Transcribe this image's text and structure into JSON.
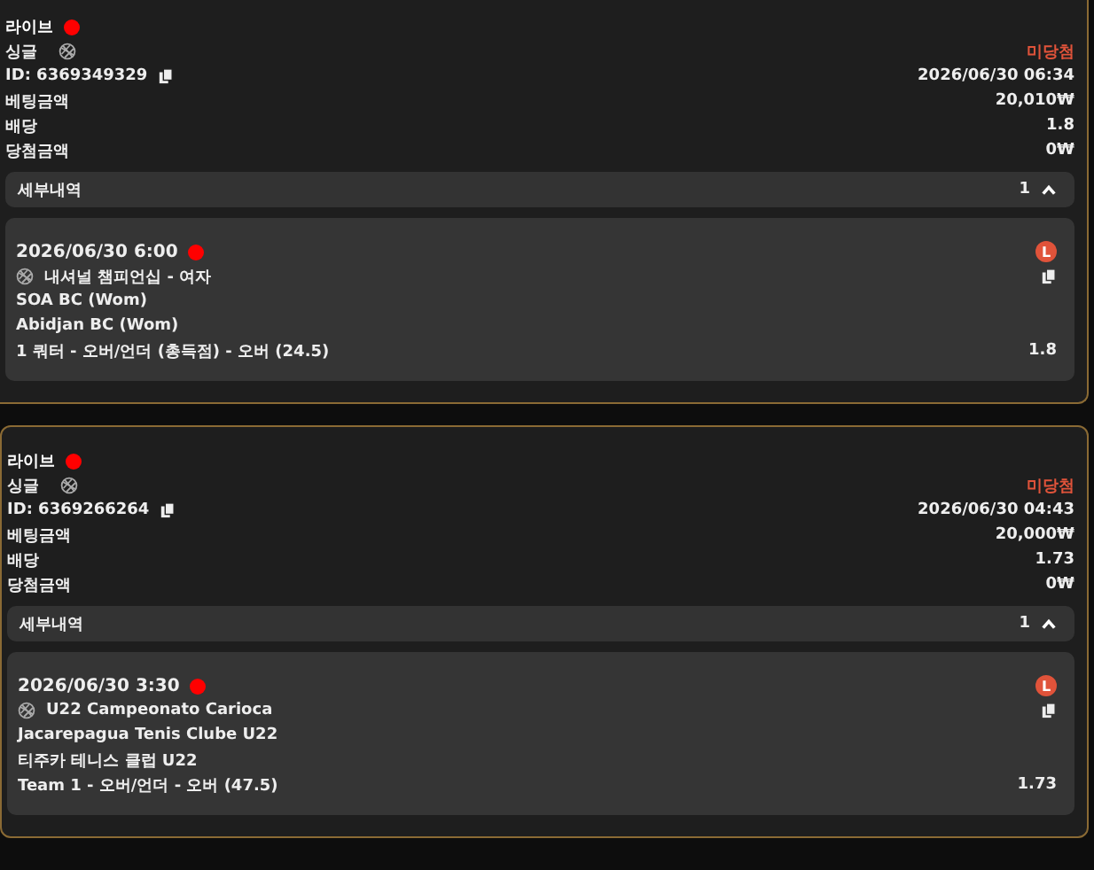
{
  "bets": [
    {
      "live_label": "라이브",
      "bet_type": "싱글",
      "status": "미당첨",
      "id": "ID: 6369349329",
      "placed_at": "2026/06/30 06:34",
      "rows": [
        {
          "label": "베팅금액",
          "value": "20,010₩"
        },
        {
          "label": "배당",
          "value": "1.8"
        },
        {
          "label": "당첨금액",
          "value": "0₩"
        }
      ],
      "details": {
        "label": "세부내역",
        "count": "1",
        "expanded": true
      },
      "selections": [
        {
          "time": "2026/06/30 6:00",
          "badge": "L",
          "league": "내셔널 챔피언십 - 여자",
          "home": "SOA BC (Wom)",
          "away": "Abidjan BC (Wom)",
          "market": "1 쿼터 - 오버/언더 (총득점) - 오버 (24.5)",
          "odds": "1.8"
        }
      ]
    },
    {
      "live_label": "라이브",
      "bet_type": "싱글",
      "status": "미당첨",
      "id": "ID: 6369266264",
      "placed_at": "2026/06/30 04:43",
      "rows": [
        {
          "label": "베팅금액",
          "value": "20,000₩"
        },
        {
          "label": "배당",
          "value": "1.73"
        },
        {
          "label": "당첨금액",
          "value": "0₩"
        }
      ],
      "details": {
        "label": "세부내역",
        "count": "1",
        "expanded": true
      },
      "selections": [
        {
          "time": "2026/06/30 3:30",
          "badge": "L",
          "league": "U22 Campeonato Carioca",
          "home": "Jacarepagua Tenis Clube U22",
          "away": "티주카 테니스 클럽 U22",
          "market": "Team 1 - 오버/언더 - 오버 (47.5)",
          "odds": "1.73"
        }
      ]
    }
  ]
}
